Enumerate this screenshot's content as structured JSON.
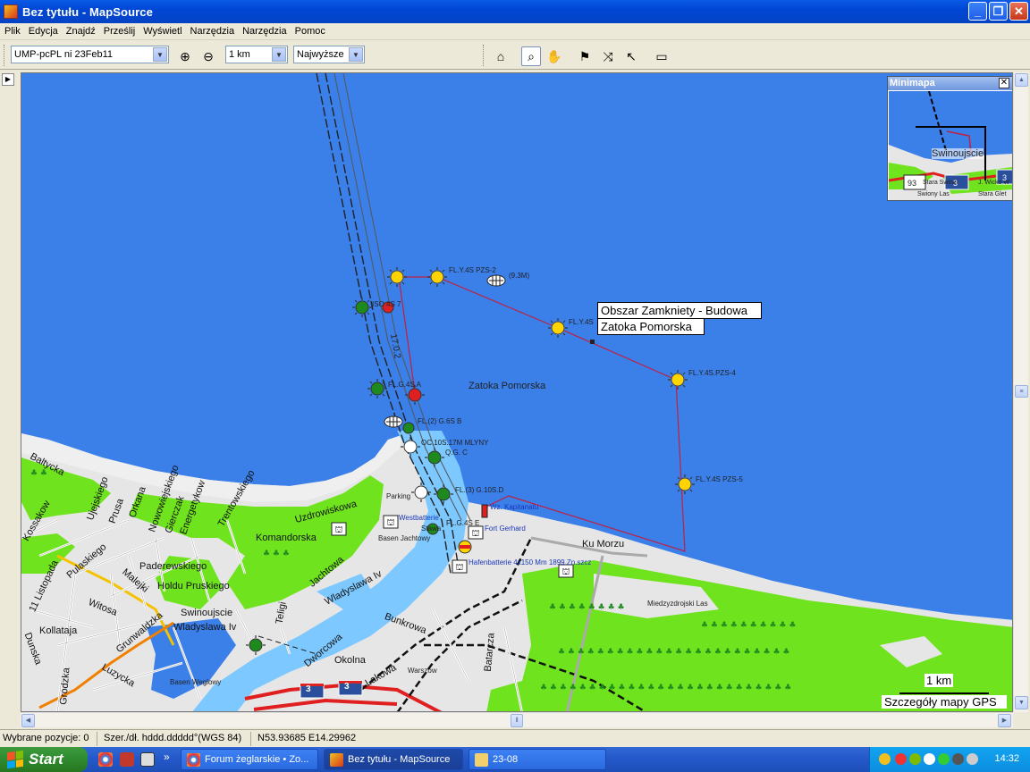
{
  "window": {
    "title": "Bez tytułu - MapSource"
  },
  "menu": [
    "Plik",
    "Edycja",
    "Znajdź",
    "Prześlij",
    "Wyświetl",
    "Narzędzia",
    "Narzędzia",
    "Pomoc"
  ],
  "toolbar": {
    "map_product": "UMP-pcPL ni 23Feb11",
    "zoom_scale": "1 km",
    "detail_level": "Najwyższe"
  },
  "map": {
    "tooltip": {
      "line1": "Obszar Zamkniety - Budowa",
      "line2": "Zatoka Pomorska"
    },
    "sea_label": "Zatoka Pomorska",
    "channel_label": "17.0.2",
    "nav_labels": {
      "a": "FL.Y.4S PZS-2",
      "b": "(9.3M)",
      "c": "FL.Y.4S",
      "d": "FL.Y.4S.PZS-4",
      "e": "FL.Y.4S PZS-5",
      "f": "ISO 4S 7",
      "g": "FL.G.4S A",
      "h": "FL.(2) G.6S B",
      "i": "OC.10S.17M MLYNY",
      "j": "Q.G. C",
      "k": "FL.(3) G.10S.D",
      "l": "Parking",
      "m": "FL.G.4S E",
      "n": "Stawa"
    },
    "poi_labels": {
      "westbatterie": "Westbatterie",
      "basen": "Basen Jachtowy",
      "kapitanat": "Wz. Kapitanatu",
      "fort": "Fort Gerhard",
      "hafen": "Hafenbatterie 4x150 Mm 1899 Zn.szcz",
      "miedzyzdroje": "Miedzyzdrojski Las",
      "basen_weglowy": "Basen Weglowy",
      "warszow": "Warszow"
    },
    "streets": {
      "baltycka": "Baltycka",
      "kossakow": "Kossakow",
      "ujejskiego": "Ujejskiego",
      "prusa": "Prusa",
      "orkana": "Orkana",
      "nowowiejskiego": "Nowowiejskiego",
      "gierczak": "Gierczak",
      "energetykow": "Energetykow",
      "trentowskiego": "Trentowskiego",
      "uzdrowiskowa": "Uzdrowiskowa",
      "komandorska": "Komandorska",
      "paderewskiego": "Paderewskiego",
      "holdu": "Holdu Pruskiego",
      "jachtowa": "Jachtowa",
      "wladyslawa_iv_a": "Wladyslawa Iv",
      "swinoujscie": "Swinoujscie",
      "wladyslawa_iv_b": "Wladyslawa Iv",
      "listopada": "11 Listopada",
      "pulaskiego": "Pulaskiego",
      "malejki": "Malejki",
      "witosa": "Witosa",
      "kollataja": "Kollataja",
      "grunwaldzka": "Grunwaldzka",
      "luzycka": "Luzycka",
      "grodzka": "Grodzka",
      "dunska": "Dunska",
      "teligi": "Teligi",
      "dworcowa": "Dworcowa",
      "okolna": "Okolna",
      "lakowa": "Lakowa",
      "bunkrowa": "Bunkrowa",
      "batarcza": "Batarcza",
      "ku_morzu": "Ku Morzu"
    },
    "road_shields": [
      "3",
      "3"
    ],
    "scale": {
      "label": "1 km",
      "detail": "Szczegóły mapy GPS"
    }
  },
  "minimap": {
    "title": "Minimapa",
    "labels": {
      "city": "Swinoujscie",
      "a": "Stara Swinar",
      "b": "J. Wicko W",
      "c": "Swiony Las",
      "d": "Stara Glet"
    },
    "shields": [
      "93",
      "3",
      "3"
    ]
  },
  "status": {
    "selected": "Wybrane pozycje: 0",
    "format": "Szer./dł. hddd.ddddd°(WGS 84)",
    "coords": "N53.93685 E14.29962"
  },
  "taskbar": {
    "start": "Start",
    "tasks": [
      "Forum żeglarskie • Zo...",
      "Bez tytułu - MapSource",
      "23-08"
    ],
    "clock": "14:32"
  },
  "colors": {
    "sea": "#3b7fe9",
    "land": "#e6e6e6",
    "forest": "#6fe31d",
    "route": "#c02040",
    "titlebar": "#0a5ae6"
  }
}
